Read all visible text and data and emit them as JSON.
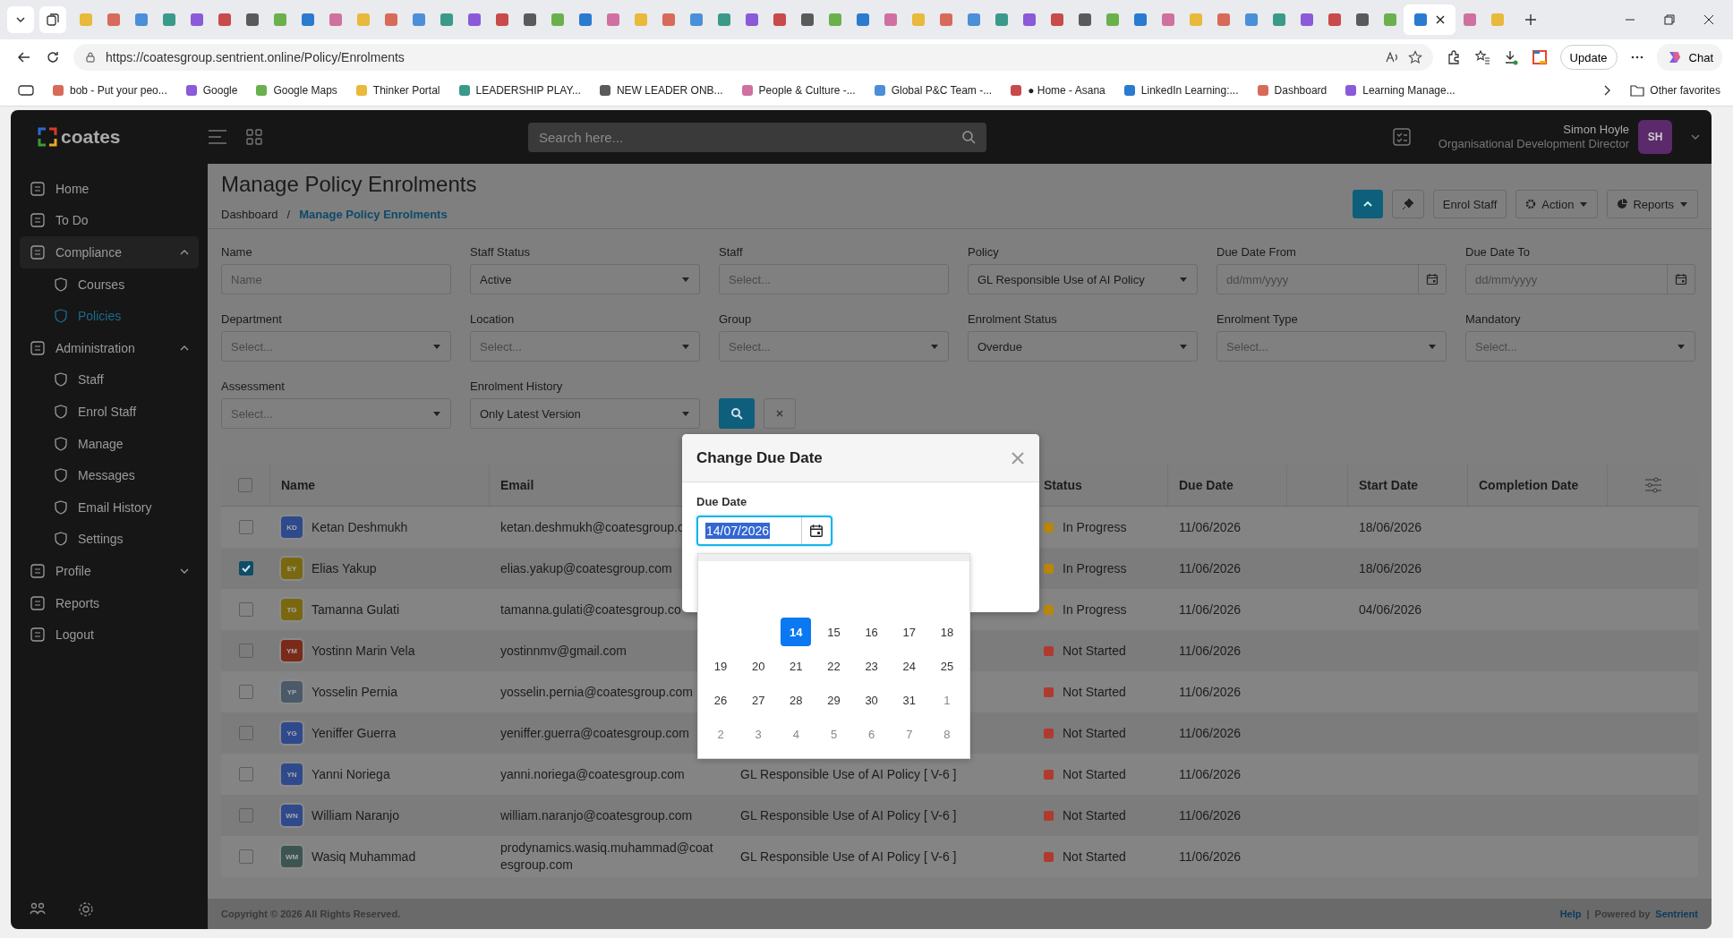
{
  "browser": {
    "tabs": [
      {
        "selected": false
      },
      {
        "selected": false
      },
      {
        "selected": false
      },
      {
        "selected": false
      },
      {
        "selected": false
      },
      {
        "selected": false
      },
      {
        "selected": false
      },
      {
        "selected": false
      },
      {
        "selected": false
      },
      {
        "selected": false
      },
      {
        "selected": false
      },
      {
        "selected": false
      },
      {
        "selected": false
      },
      {
        "selected": false
      },
      {
        "selected": false
      },
      {
        "selected": false
      },
      {
        "selected": false
      },
      {
        "selected": false
      },
      {
        "selected": false
      },
      {
        "selected": false
      },
      {
        "selected": false
      },
      {
        "selected": false
      },
      {
        "selected": false
      },
      {
        "selected": false
      },
      {
        "selected": false
      },
      {
        "selected": false
      },
      {
        "selected": false
      },
      {
        "selected": false
      },
      {
        "selected": false
      },
      {
        "selected": false
      },
      {
        "selected": false
      },
      {
        "selected": false
      },
      {
        "selected": false
      },
      {
        "selected": false
      },
      {
        "selected": false
      },
      {
        "selected": false
      },
      {
        "selected": false
      },
      {
        "selected": false
      },
      {
        "selected": false
      },
      {
        "selected": false
      },
      {
        "selected": false
      },
      {
        "selected": false
      },
      {
        "selected": false
      },
      {
        "selected": false
      },
      {
        "selected": false
      },
      {
        "selected": false
      },
      {
        "selected": false
      },
      {
        "selected": false
      },
      {
        "selected": true
      },
      {
        "selected": false
      },
      {
        "selected": false
      }
    ],
    "url": "https://coatesgroup.sentrient.online/Policy/Enrolments",
    "update_label": "Update",
    "chat_label": "Chat",
    "favorites": [
      "bob - Put your peo...",
      "Google",
      "Google Maps",
      "Thinker Portal",
      "LEADERSHIP PLAY...",
      "NEW LEADER ONB...",
      "People & Culture -...",
      "Global P&C Team -...",
      "● Home - Asana",
      "LinkedIn Learning:...",
      "Dashboard",
      "Learning Manage..."
    ],
    "other_favorites": "Other favorites"
  },
  "app": {
    "logo": "coates",
    "search_placeholder": "Search here...",
    "user": {
      "name": "Simon Hoyle",
      "role": "Organisational Development Director",
      "initials": "SH"
    },
    "sidebar": [
      {
        "label": "Home",
        "selected": false
      },
      {
        "label": "To Do",
        "selected": false
      },
      {
        "label": "Compliance",
        "selected": true,
        "expanded": true,
        "children": [
          {
            "label": "Courses",
            "selected": false
          },
          {
            "label": "Policies",
            "selected": true
          }
        ]
      },
      {
        "label": "Administration",
        "selected": false,
        "expanded": true,
        "children": [
          {
            "label": "Staff",
            "selected": false
          },
          {
            "label": "Enrol Staff",
            "selected": false
          },
          {
            "label": "Manage",
            "selected": false
          },
          {
            "label": "Messages",
            "selected": false
          },
          {
            "label": "Email History",
            "selected": false
          },
          {
            "label": "Settings",
            "selected": false
          }
        ]
      },
      {
        "label": "Profile",
        "selected": false,
        "expanded": false
      },
      {
        "label": "Reports",
        "selected": false
      },
      {
        "label": "Logout",
        "selected": false
      }
    ],
    "page_title": "Manage Policy Enrolments",
    "breadcrumb": [
      "Dashboard",
      "Manage Policy Enrolments"
    ],
    "breadcrumb_separator": "/",
    "header_buttons": [
      "Enrol Staff",
      "Action",
      "Reports"
    ],
    "filters": [
      {
        "label": "Name",
        "kind": "text",
        "placeholder": "Name"
      },
      {
        "label": "Staff Status",
        "kind": "select",
        "value": "Active"
      },
      {
        "label": "Staff",
        "kind": "text",
        "placeholder": "Select..."
      },
      {
        "label": "Policy",
        "kind": "select",
        "value": "GL Responsible Use of AI Policy"
      },
      {
        "label": "Due Date From",
        "kind": "date",
        "placeholder": "dd/mm/yyyy"
      },
      {
        "label": "Due Date To",
        "kind": "date",
        "placeholder": "dd/mm/yyyy"
      },
      {
        "label": "Department",
        "kind": "select",
        "placeholder": "Select..."
      },
      {
        "label": "Location",
        "kind": "select",
        "placeholder": "Select..."
      },
      {
        "label": "Group",
        "kind": "select",
        "placeholder": "Select..."
      },
      {
        "label": "Enrolment Status",
        "kind": "select",
        "value": "Overdue"
      },
      {
        "label": "Enrolment Type",
        "kind": "select",
        "placeholder": "Select..."
      },
      {
        "label": "Mandatory",
        "kind": "select",
        "placeholder": "Select..."
      },
      {
        "label": "Assessment",
        "kind": "select",
        "placeholder": "Select..."
      },
      {
        "label": "Enrolment History",
        "kind": "select",
        "value": "Only Latest Version"
      }
    ],
    "table": {
      "all_checked": false,
      "columns": [
        "Name",
        "Email",
        "Status",
        "Due Date",
        "Start Date",
        "Completion Date"
      ],
      "rows": [
        {
          "checked": false,
          "avatar": {
            "initials": "KD",
            "color": "#2f4a8c"
          },
          "name": "Ketan Deshmukh",
          "email": "ketan.deshmukh@coatesgroup.c",
          "status": {
            "label": "In Progress",
            "color": "#b8860b"
          },
          "due": "11/06/2026",
          "start": "18/06/2026"
        },
        {
          "checked": true,
          "avatar": {
            "initials": "EY",
            "color": "#7a6810"
          },
          "name": "Elias Yakup",
          "email": "elias.yakup@coatesgroup.com",
          "status": {
            "label": "In Progress",
            "color": "#b8860b"
          },
          "due": "11/06/2026",
          "start": "18/06/2026"
        },
        {
          "checked": false,
          "avatar": {
            "initials": "TG",
            "color": "#7a6810"
          },
          "name": "Tamanna Gulati",
          "email": "tamanna.gulati@coatesgroup.co",
          "status": {
            "label": "In Progress",
            "color": "#b8860b"
          },
          "due": "11/06/2026",
          "start": "04/06/2026"
        },
        {
          "checked": false,
          "avatar": {
            "initials": "YM",
            "color": "#7a2a18"
          },
          "name": "Yostinn Marin Vela",
          "email": "yostinnmv@gmail.com",
          "status": {
            "label": "Not Started",
            "color": "#b03a2e"
          },
          "due": "11/06/2026"
        },
        {
          "checked": false,
          "avatar": {
            "initials": "YP",
            "color": "#4a5a68"
          },
          "name": "Yosselin Pernia",
          "email": "yosselin.pernia@coatesgroup.com",
          "status": {
            "label": "Not Started",
            "color": "#b03a2e"
          },
          "due": "11/06/2026"
        },
        {
          "checked": false,
          "avatar": {
            "initials": "YG",
            "color": "#2f4a8c"
          },
          "name": "Yeniffer Guerra",
          "email": "yeniffer.guerra@coatesgroup.com",
          "status": {
            "label": "Not Started",
            "color": "#b03a2e"
          },
          "due": "11/06/2026"
        },
        {
          "checked": false,
          "avatar": {
            "initials": "YN",
            "color": "#2f4a8c"
          },
          "name": "Yanni Noriega",
          "email": "yanni.noriega@coatesgroup.com",
          "policy": "GL Responsible Use of AI Policy [ V-6 ]",
          "status": {
            "label": "Not Started",
            "color": "#b03a2e"
          },
          "due": "11/06/2026"
        },
        {
          "checked": false,
          "avatar": {
            "initials": "WN",
            "color": "#2f4a8c"
          },
          "name": "William Naranjo",
          "email": "william.naranjo@coatesgroup.com",
          "policy": "GL Responsible Use of AI Policy [ V-6 ]",
          "status": {
            "label": "Not Started",
            "color": "#b03a2e"
          },
          "due": "11/06/2026"
        },
        {
          "checked": false,
          "avatar": {
            "initials": "WM",
            "color": "#3d5550"
          },
          "name": "Wasiq Muhammad",
          "email": "prodynamics.wasiq.muhammad@coatesgroup.com",
          "policy": "GL Responsible Use of AI Policy [ V-6 ]",
          "status": {
            "label": "Not Started",
            "color": "#b03a2e"
          },
          "due": "11/06/2026"
        }
      ]
    },
    "footer": {
      "copyright": "Copyright © 2026 All Rights Reserved.",
      "help": "Help",
      "separator": "|",
      "powered_by": "Powered by",
      "brand": "Sentrient"
    },
    "dialog": {
      "title": "Change Due Date",
      "field_label": "Due Date",
      "value": "14/07/2026",
      "weeks": [
        [
          {
            "label": "14",
            "selected": true,
            "muted": false
          },
          {
            "label": "15",
            "selected": false,
            "muted": false
          },
          {
            "label": "16",
            "selected": false,
            "muted": false
          },
          {
            "label": "17",
            "selected": false,
            "muted": false
          },
          {
            "label": "18",
            "selected": false,
            "muted": false
          }
        ],
        [
          {
            "label": "19",
            "selected": false,
            "muted": false
          },
          {
            "label": "20",
            "selected": false,
            "muted": false
          },
          {
            "label": "21",
            "selected": false,
            "muted": false
          },
          {
            "label": "22",
            "selected": false,
            "muted": false
          },
          {
            "label": "23",
            "selected": false,
            "muted": false
          },
          {
            "label": "24",
            "selected": false,
            "muted": false
          },
          {
            "label": "25",
            "selected": false,
            "muted": false
          }
        ],
        [
          {
            "label": "26",
            "selected": false,
            "muted": false
          },
          {
            "label": "27",
            "selected": false,
            "muted": false
          },
          {
            "label": "28",
            "selected": false,
            "muted": false
          },
          {
            "label": "29",
            "selected": false,
            "muted": false
          },
          {
            "label": "30",
            "selected": false,
            "muted": false
          },
          {
            "label": "31",
            "selected": false,
            "muted": false
          },
          {
            "label": "1",
            "selected": false,
            "muted": true
          }
        ],
        [
          {
            "label": "2",
            "selected": false,
            "muted": true
          },
          {
            "label": "3",
            "selected": false,
            "muted": true
          },
          {
            "label": "4",
            "selected": false,
            "muted": true
          },
          {
            "label": "5",
            "selected": false,
            "muted": true
          },
          {
            "label": "6",
            "selected": false,
            "muted": true
          },
          {
            "label": "7",
            "selected": false,
            "muted": true
          },
          {
            "label": "8",
            "selected": false,
            "muted": true
          }
        ]
      ]
    }
  }
}
